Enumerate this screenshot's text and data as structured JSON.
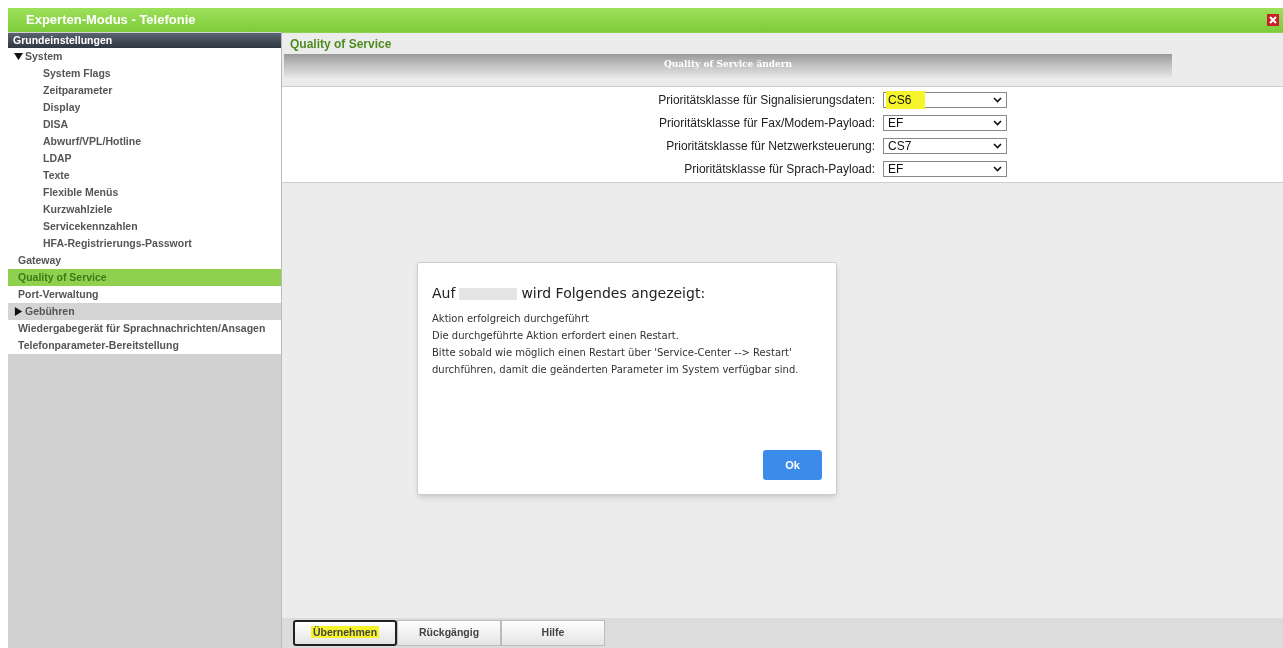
{
  "window": {
    "title": "Experten-Modus - Telefonie"
  },
  "sidebar": {
    "header": "Grundeinstellungen",
    "items": [
      {
        "label": "System",
        "kind": "group",
        "expanded": true,
        "selected": false,
        "children": [
          {
            "label": "System Flags",
            "selected": false
          },
          {
            "label": "Zeitparameter",
            "selected": false
          },
          {
            "label": "Display",
            "selected": false
          },
          {
            "label": "DISA",
            "selected": false
          },
          {
            "label": "Abwurf/VPL/Hotline",
            "selected": false
          },
          {
            "label": "LDAP",
            "selected": false
          },
          {
            "label": "Texte",
            "selected": false
          },
          {
            "label": "Flexible Menüs",
            "selected": false
          },
          {
            "label": "Kurzwahlziele",
            "selected": false
          },
          {
            "label": "Servicekennzahlen",
            "selected": false
          },
          {
            "label": "HFA-Registrierungs-Passwort",
            "selected": false
          }
        ]
      },
      {
        "label": "Gateway",
        "kind": "item",
        "selected": false
      },
      {
        "label": "Quality of Service",
        "kind": "item",
        "selected": true
      },
      {
        "label": "Port-Verwaltung",
        "kind": "item",
        "selected": false
      },
      {
        "label": "Gebühren",
        "kind": "group",
        "expanded": false,
        "selected": false
      },
      {
        "label": "Wiedergabegerät für Sprachnachrichten/Ansagen",
        "kind": "item",
        "selected": false
      },
      {
        "label": "Telefonparameter-Bereitstellung",
        "kind": "item",
        "selected": false
      }
    ]
  },
  "page": {
    "title": "Quality of Service",
    "panel_title": "Quality of Service ändern",
    "fields": [
      {
        "label": "Prioritätsklasse für Signalisierungsdaten:",
        "value": "CS6",
        "highlighted": true
      },
      {
        "label": "Prioritätsklasse für Fax/Modem-Payload:",
        "value": "EF",
        "highlighted": false
      },
      {
        "label": "Prioritätsklasse für Netzwerksteuerung:",
        "value": "CS7",
        "highlighted": false
      },
      {
        "label": "Prioritätsklasse für Sprach-Payload:",
        "value": "EF",
        "highlighted": false
      }
    ]
  },
  "dialog": {
    "title_before": "Auf",
    "title_after": "wird Folgendes angezeigt:",
    "lines": [
      "Aktion erfolgreich durchgeführt",
      "Die durchgeführte Aktion erfordert einen Restart.",
      "Bitte sobald wie möglich einen Restart über 'Service-Center --> Restart'",
      "durchführen, damit die geänderten Parameter im System verfügbar sind."
    ],
    "button": "Ok"
  },
  "buttons": [
    {
      "label": "Übernehmen",
      "highlighted": true,
      "focused": true
    },
    {
      "label": "Rückgängig",
      "highlighted": false,
      "focused": false
    },
    {
      "label": "Hilfe",
      "highlighted": false,
      "focused": false
    }
  ]
}
